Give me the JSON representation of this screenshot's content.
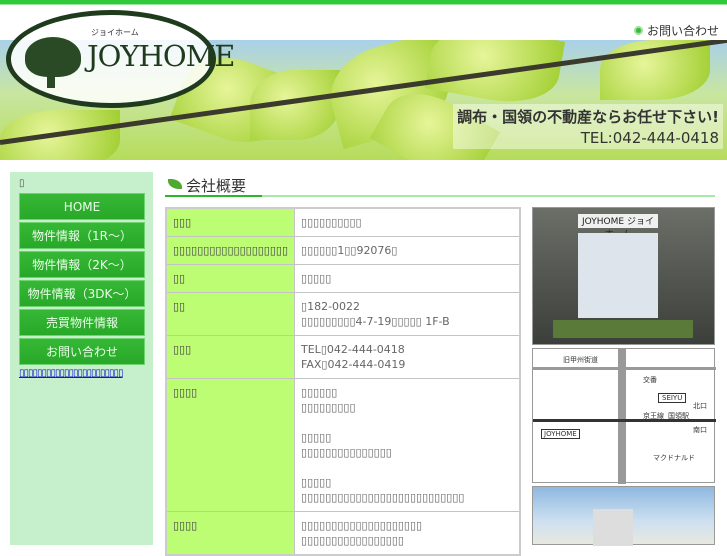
{
  "header": {
    "contact_link": "お問い合わせ",
    "logo_kana": "ジョイホーム",
    "logo_name": "JOYHOME",
    "slogan": "調布・国領の不動産ならお任せ下さい!",
    "tel": "TEL:042-444-0418"
  },
  "sidebar": {
    "glyph": "▯",
    "nav": [
      {
        "label": "HOME"
      },
      {
        "label": "物件情報（1R～）"
      },
      {
        "label": "物件情報（2K～）"
      },
      {
        "label": "物件情報（3DK～）"
      },
      {
        "label": "売買物件情報"
      },
      {
        "label": "お問い合わせ"
      }
    ],
    "link": "▯▯▯▯▯▯▯▯▯▯▯▯▯▯▯▯▯▯▯▯▯▯▯"
  },
  "main": {
    "heading": "会社概要",
    "rows": [
      {
        "key": "▯▯▯",
        "lines": [
          "▯▯▯▯▯▯▯▯▯▯"
        ]
      },
      {
        "key": "▯▯▯▯▯▯▯▯▯▯▯▯▯▯▯▯▯▯▯",
        "lines": [
          "▯▯▯▯▯▯1▯▯92076▯"
        ]
      },
      {
        "key": "▯▯",
        "lines": [
          "▯▯▯▯▯"
        ]
      },
      {
        "key": "▯▯",
        "lines": [
          "▯182-0022",
          "▯▯▯▯▯▯▯▯▯4-7-19▯▯▯▯▯ 1F-B"
        ]
      },
      {
        "key": "▯▯▯",
        "lines": [
          "TEL▯042-444-0418",
          "FAX▯042-444-0419"
        ]
      },
      {
        "key": "▯▯▯▯",
        "lines": [
          "▯▯▯▯▯▯",
          "▯▯▯▯▯▯▯▯▯",
          "",
          "▯▯▯▯▯",
          "▯▯▯▯▯▯▯▯▯▯▯▯▯▯▯",
          "",
          "▯▯▯▯▯",
          "▯▯▯▯▯▯▯▯▯▯▯▯▯▯▯▯▯▯▯▯▯▯▯▯▯▯▯"
        ]
      },
      {
        "key": "▯▯▯▯",
        "lines": [
          "▯▯▯▯▯▯▯▯▯▯▯▯▯▯▯▯▯▯▯▯",
          "▯▯▯▯▯▯▯▯▯▯▯▯▯▯▯▯▯"
        ]
      }
    ]
  },
  "photos": {
    "shop_sign": "JOYHOME ジョイホーム",
    "map_labels": [
      "旧甲州街道",
      "交番",
      "SEIYU",
      "京王線",
      "国領駅",
      "北口",
      "南口",
      "マクドナルド",
      "JOYHOME"
    ]
  }
}
